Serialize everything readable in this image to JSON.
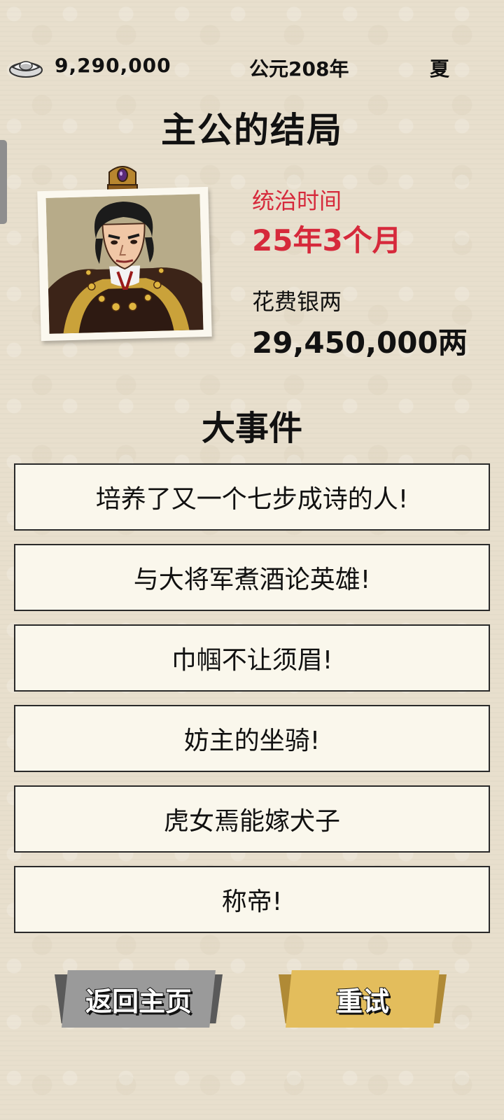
{
  "topbar": {
    "silver_icon": "silver-ingot-icon",
    "silver_amount": "9,290,000",
    "year": "公元208年",
    "season": "夏"
  },
  "page_title": "主公的结局",
  "portrait": {
    "icon": "lord-portrait"
  },
  "stats": {
    "reign_label": "统治时间",
    "reign_value": "25年3个月",
    "cost_label": "花费银两",
    "cost_value": "29,450,000两"
  },
  "events_title": "大事件",
  "events": [
    {
      "text": "培养了又一个七步成诗的人!"
    },
    {
      "text": "与大将军煮酒论英雄!"
    },
    {
      "text": "巾帼不让须眉!"
    },
    {
      "text": "妨主的坐骑!"
    },
    {
      "text": "虎女焉能嫁犬子"
    },
    {
      "text": "称帝!"
    }
  ],
  "buttons": {
    "home_label": "返回主页",
    "retry_label": "重试"
  },
  "colors": {
    "background": "#e8dfcd",
    "highlight_red": "#d6293b",
    "home_button": "#9a9a9a",
    "retry_button": "#e3bd5c",
    "event_card": "#faf7ec"
  }
}
